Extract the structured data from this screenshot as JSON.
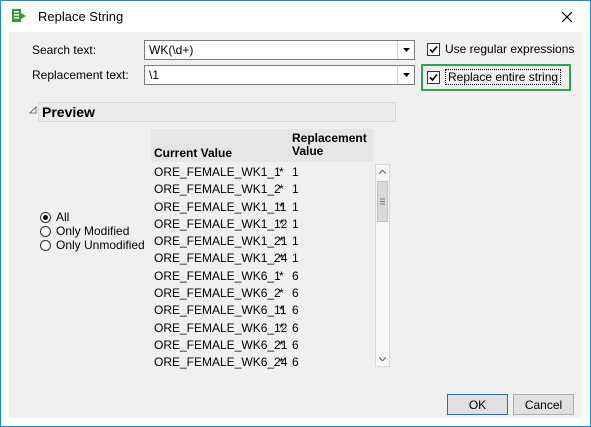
{
  "window": {
    "title": "Replace String"
  },
  "search": {
    "label": "Search text:",
    "value": "WK(\\d+)"
  },
  "replacement": {
    "label": "Replacement text:",
    "value": "\\1"
  },
  "options": {
    "use_regex_label": "Use regular expressions",
    "use_regex_checked": true,
    "replace_entire_label": "Replace entire string",
    "replace_entire_checked": true
  },
  "preview": {
    "title": "Preview"
  },
  "filter": {
    "all": "All",
    "only_modified": "Only Modified",
    "only_unmodified": "Only Unmodified",
    "selected": "All"
  },
  "table": {
    "col_current": "Current Value",
    "col_replacement_line1": "Replacement",
    "col_replacement_line2": "Value",
    "rows": [
      {
        "current": "ORE_FEMALE_WK1_1",
        "mark": "*",
        "replacement": "1"
      },
      {
        "current": "ORE_FEMALE_WK1_2",
        "mark": "*",
        "replacement": "1"
      },
      {
        "current": "ORE_FEMALE_WK1_11",
        "mark": "*",
        "replacement": "1"
      },
      {
        "current": "ORE_FEMALE_WK1_12",
        "mark": "*",
        "replacement": "1"
      },
      {
        "current": "ORE_FEMALE_WK1_21",
        "mark": "*",
        "replacement": "1"
      },
      {
        "current": "ORE_FEMALE_WK1_24",
        "mark": "*",
        "replacement": "1"
      },
      {
        "current": "ORE_FEMALE_WK6_1",
        "mark": "*",
        "replacement": "6"
      },
      {
        "current": "ORE_FEMALE_WK6_2",
        "mark": "*",
        "replacement": "6"
      },
      {
        "current": "ORE_FEMALE_WK6_11",
        "mark": "*",
        "replacement": "6"
      },
      {
        "current": "ORE_FEMALE_WK6_12",
        "mark": "*",
        "replacement": "6"
      },
      {
        "current": "ORE_FEMALE_WK6_21",
        "mark": "*",
        "replacement": "6"
      },
      {
        "current": "ORE_FEMALE_WK6_24",
        "mark": "*",
        "replacement": "6"
      }
    ]
  },
  "buttons": {
    "ok": "OK",
    "cancel": "Cancel"
  },
  "icons": {
    "app": "replace-string-app-icon",
    "close": "close-icon",
    "dropdown": "chevron-down-icon",
    "collapse": "collapse-triangle-icon"
  },
  "colors": {
    "highlight": "#2ea44f",
    "window_border": "#1c8ad8",
    "default_button": "#0078d7"
  }
}
